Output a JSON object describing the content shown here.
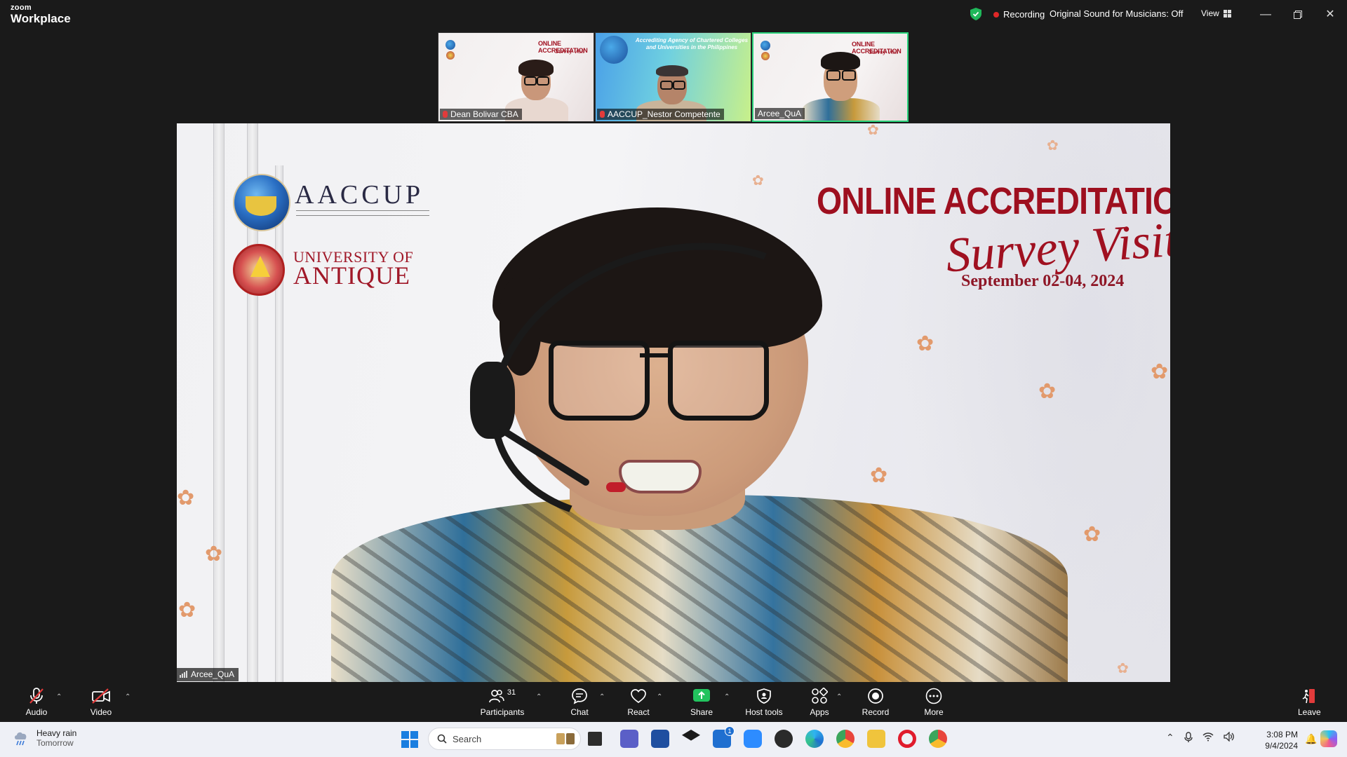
{
  "app": {
    "brand_top": "zoom",
    "brand_bottom": "Workplace"
  },
  "topbar": {
    "recording": "Recording",
    "sound": "Original Sound for Musicians: Off",
    "view": "View"
  },
  "thumbnails": [
    {
      "name": "Dean Bolivar CBA",
      "muted": true,
      "active": false,
      "slide_title": "ONLINE ACCREDITATION",
      "slide_script": "Survey Visit"
    },
    {
      "name": "AACCUP_Nestor Competente",
      "muted": true,
      "active": false,
      "slide_line1": "Accrediting Agency of Chartered Colleges",
      "slide_line2": "and Universities in the Philippines"
    },
    {
      "name": "Arcee_QuA",
      "muted": false,
      "active": true,
      "slide_title": "ONLINE ACCREDITATION",
      "slide_script": "Survey Visit"
    }
  ],
  "main": {
    "speaker": "Arcee_QuA",
    "aaccup": "AACCUP",
    "university_line1": "UNIVERSITY OF",
    "university_line2": "ANTIQUE",
    "title": "ONLINE ACCREDITATION",
    "script": "Survey Visit",
    "date": "September 02-04, 2024"
  },
  "toolbar": {
    "audio": "Audio",
    "video": "Video",
    "participants": "Participants",
    "participants_count": "31",
    "chat": "Chat",
    "react": "React",
    "share": "Share",
    "host_tools": "Host tools",
    "apps": "Apps",
    "record": "Record",
    "more": "More",
    "leave": "Leave"
  },
  "taskbar": {
    "weather_line1": "Heavy rain",
    "weather_line2": "Tomorrow",
    "search_placeholder": "Search",
    "mail_badge": "1",
    "time": "3:08 PM",
    "date": "9/4/2024"
  },
  "colors": {
    "active_border": "#29d17a",
    "recording_dot": "#e02828",
    "share_green": "#22c35e",
    "title_red": "#9e0f1f"
  }
}
